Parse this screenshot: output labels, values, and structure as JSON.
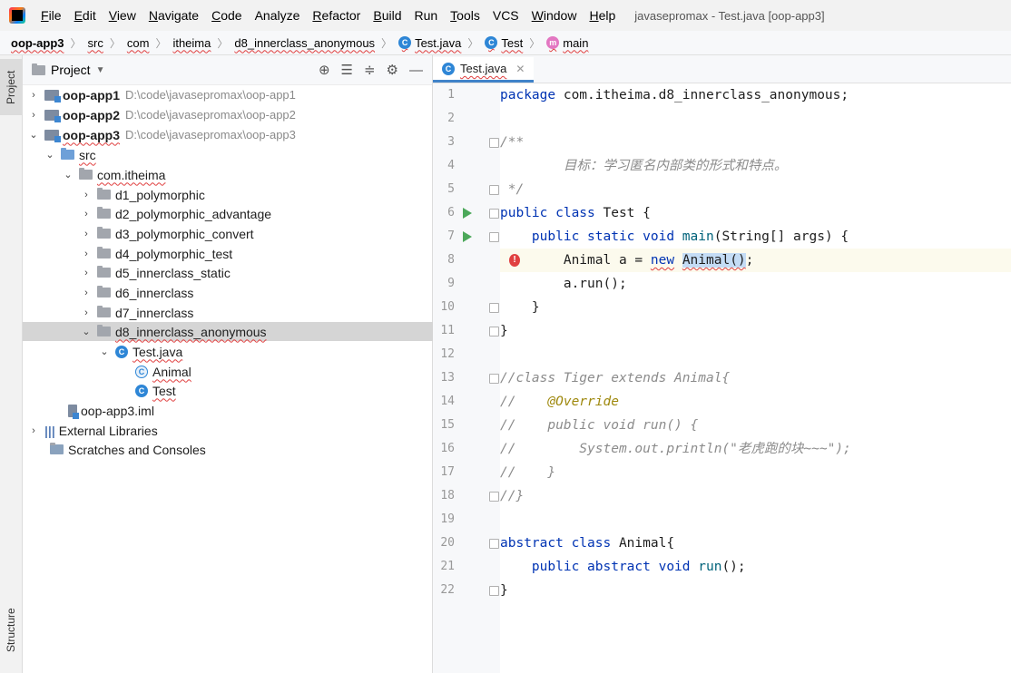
{
  "menubar": {
    "items": [
      {
        "label": "File",
        "u": "F",
        "rest": "ile"
      },
      {
        "label": "Edit",
        "u": "E",
        "rest": "dit"
      },
      {
        "label": "View",
        "u": "V",
        "rest": "iew"
      },
      {
        "label": "Navigate",
        "u": "N",
        "rest": "avigate"
      },
      {
        "label": "Code",
        "u": "C",
        "rest": "ode"
      },
      {
        "label": "Analyze",
        "u": "",
        "rest": "Analyze"
      },
      {
        "label": "Refactor",
        "u": "R",
        "rest": "efactor"
      },
      {
        "label": "Build",
        "u": "B",
        "rest": "uild"
      },
      {
        "label": "Run",
        "u": "",
        "rest": "Run"
      },
      {
        "label": "Tools",
        "u": "T",
        "rest": "ools"
      },
      {
        "label": "VCS",
        "u": "",
        "rest": "VCS"
      },
      {
        "label": "Window",
        "u": "W",
        "rest": "indow"
      },
      {
        "label": "Help",
        "u": "H",
        "rest": "elp"
      }
    ],
    "window_title": "javasepromax - Test.java [oop-app3]"
  },
  "breadcrumb": [
    "oop-app3",
    "src",
    "com",
    "itheima",
    "d8_innerclass_anonymous",
    "Test.java",
    "Test",
    "main"
  ],
  "sidebar": {
    "project_tab": "Project",
    "structure_tab": "Structure"
  },
  "project_pane": {
    "title": "Project",
    "tree": [
      {
        "label": "oop-app1",
        "path": "D:\\code\\javasepromax\\oop-app1"
      },
      {
        "label": "oop-app2",
        "path": "D:\\code\\javasepromax\\oop-app2"
      },
      {
        "label": "oop-app3",
        "path": "D:\\code\\javasepromax\\oop-app3"
      },
      {
        "label": "src"
      },
      {
        "label": "com.itheima"
      },
      {
        "label": "d1_polymorphic"
      },
      {
        "label": "d2_polymorphic_advantage"
      },
      {
        "label": "d3_polymorphic_convert"
      },
      {
        "label": "d4_polymorphic_test"
      },
      {
        "label": "d5_innerclass_static"
      },
      {
        "label": "d6_innerclass"
      },
      {
        "label": "d7_innerclass"
      },
      {
        "label": "d8_innerclass_anonymous"
      },
      {
        "label": "Test.java"
      },
      {
        "label": "Animal"
      },
      {
        "label": "Test"
      },
      {
        "label": "oop-app3.iml"
      },
      {
        "label": "External Libraries"
      },
      {
        "label": "Scratches and Consoles"
      }
    ]
  },
  "editor": {
    "tab": "Test.java",
    "line_numbers": [
      "1",
      "2",
      "3",
      "4",
      "5",
      "6",
      "7",
      "8",
      "9",
      "10",
      "11",
      "12",
      "13",
      "14",
      "15",
      "16",
      "17",
      "18",
      "19",
      "20",
      "21",
      "22"
    ],
    "code": {
      "l1a": "package",
      "l1b": " com.itheima.d8_innerclass_anonymous;",
      "l3": "/**",
      "l4": "        目标：学习匿名内部类的形式和特点。",
      "l5": " */",
      "l6a": "public class",
      "l6b": " Test {",
      "l7a": "    public static void ",
      "l7b": "main",
      "l7c": "(String[] args) {",
      "l8a": "        Animal a = ",
      "l8b": "new",
      "l8c": " ",
      "l8d": "Animal()",
      "l8e": ";",
      "l9": "        a.run();",
      "l10": "    }",
      "l11": "}",
      "l13": "//class Tiger extends Animal{",
      "l14a": "//    ",
      "l14b": "@Override",
      "l15": "//    public void run() {",
      "l16a": "//        System.out.println(",
      "l16b": "\"老虎跑的块~~~\"",
      "l16c": ");",
      "l17": "//    }",
      "l18": "//}",
      "l20a": "abstract class",
      "l20b": " Animal{",
      "l21a": "    public abstract void ",
      "l21b": "run",
      "l21c": "();",
      "l22": "}"
    }
  }
}
